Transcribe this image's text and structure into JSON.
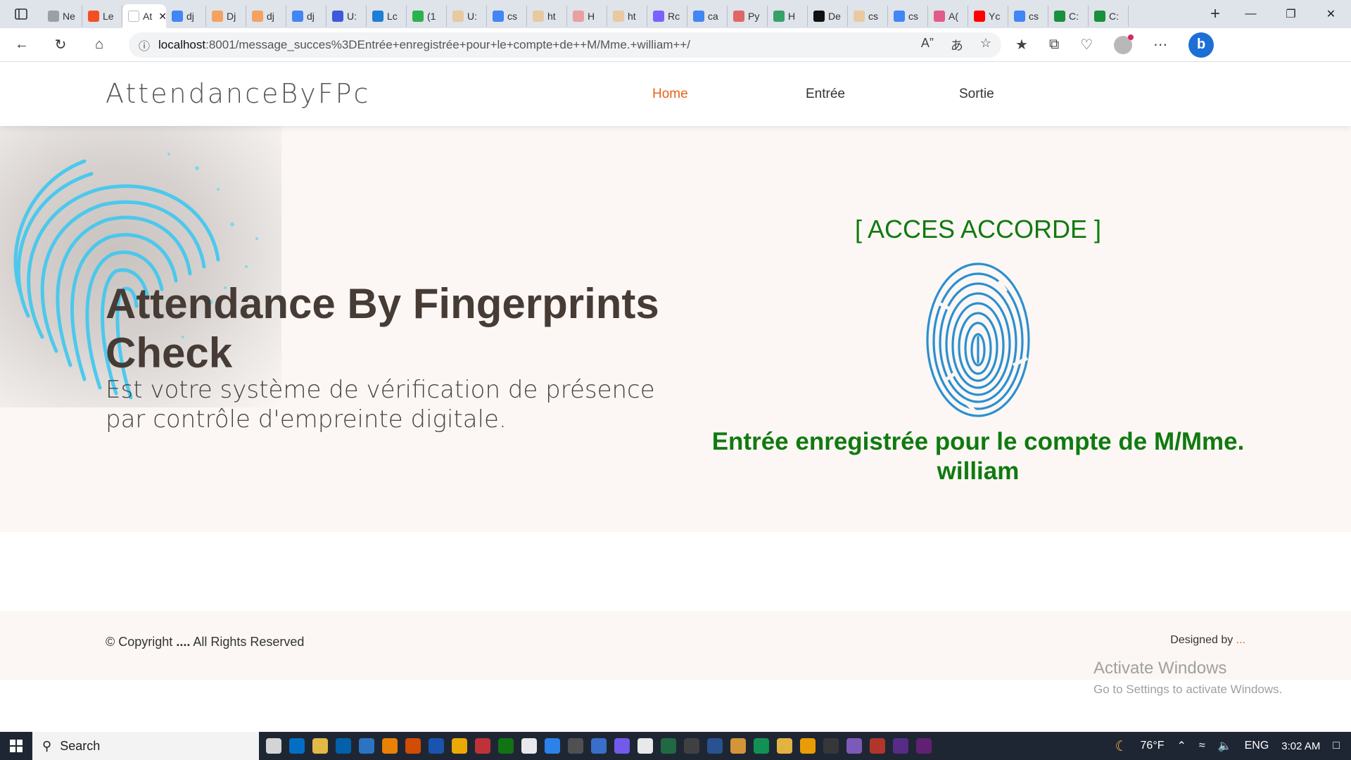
{
  "browser": {
    "tabs": [
      {
        "label": "Ne",
        "color": "#9aa0a6"
      },
      {
        "label": "Le",
        "color": "#f25022"
      },
      {
        "label": "At",
        "color": "#ffffff",
        "active": true
      },
      {
        "label": "dj",
        "color": "#4285f4"
      },
      {
        "label": "Dj",
        "color": "#f4a261"
      },
      {
        "label": "dj",
        "color": "#f4a261"
      },
      {
        "label": "dj",
        "color": "#4285f4"
      },
      {
        "label": "U:",
        "color": "#3b5bdb"
      },
      {
        "label": "Lc",
        "color": "#1c7ed6"
      },
      {
        "label": "(1",
        "color": "#2bb24c"
      },
      {
        "label": "U:",
        "color": "#e8c9a0"
      },
      {
        "label": "cs",
        "color": "#4285f4"
      },
      {
        "label": "ht",
        "color": "#e8c9a0"
      },
      {
        "label": "H",
        "color": "#e8a0a0"
      },
      {
        "label": "ht",
        "color": "#e8c9a0"
      },
      {
        "label": "Rc",
        "color": "#7b61ff"
      },
      {
        "label": "ca",
        "color": "#4285f4"
      },
      {
        "label": "Py",
        "color": "#e06666"
      },
      {
        "label": "H",
        "color": "#38a169"
      },
      {
        "label": "De",
        "color": "#111111"
      },
      {
        "label": "cs",
        "color": "#e8c9a0"
      },
      {
        "label": "cs",
        "color": "#4285f4"
      },
      {
        "label": "A(",
        "color": "#e05a8a"
      },
      {
        "label": "Yc",
        "color": "#ff0000"
      },
      {
        "label": "cs",
        "color": "#4285f4"
      },
      {
        "label": "C:",
        "color": "#1a8f3c"
      },
      {
        "label": "C:",
        "color": "#1a8f3c"
      }
    ],
    "url_host": "localhost",
    "url_path": ":8001/message_succes%3DEntrée+enregistrée+pour+le+compte+de++M/Mme.+william++/"
  },
  "site": {
    "brand": "AttendanceByFPc",
    "nav": [
      {
        "label": "Home",
        "current": true
      },
      {
        "label": "Entrée",
        "current": false
      },
      {
        "label": "Sortie",
        "current": false
      }
    ]
  },
  "hero": {
    "title": "Attendance By Fingerprints Check",
    "subtitle": "Est votre système de vérification de présence par contrôle d'empreinte digitale.",
    "access_status": "[ ACCES ACCORDE ]",
    "entry_message": "Entrée enregistrée pour le compte de M/Mme. william"
  },
  "footer": {
    "copyright_prefix": "© Copyright ",
    "copyright_bold": "....",
    "copyright_suffix": " All Rights Reserved",
    "designed_by": "Designed by ",
    "designed_dots": "..."
  },
  "watermark": {
    "title": "Activate Windows",
    "subtitle": "Go to Settings to activate Windows."
  },
  "taskbar": {
    "search_label": "Search",
    "weather": "76°F",
    "language": "ENG",
    "time": "3:02 AM"
  },
  "colors": {
    "accent": "#e4621b",
    "success": "#107a10",
    "hero_bg": "#fcf7f4",
    "fingerprint": "#2b8fd0"
  }
}
